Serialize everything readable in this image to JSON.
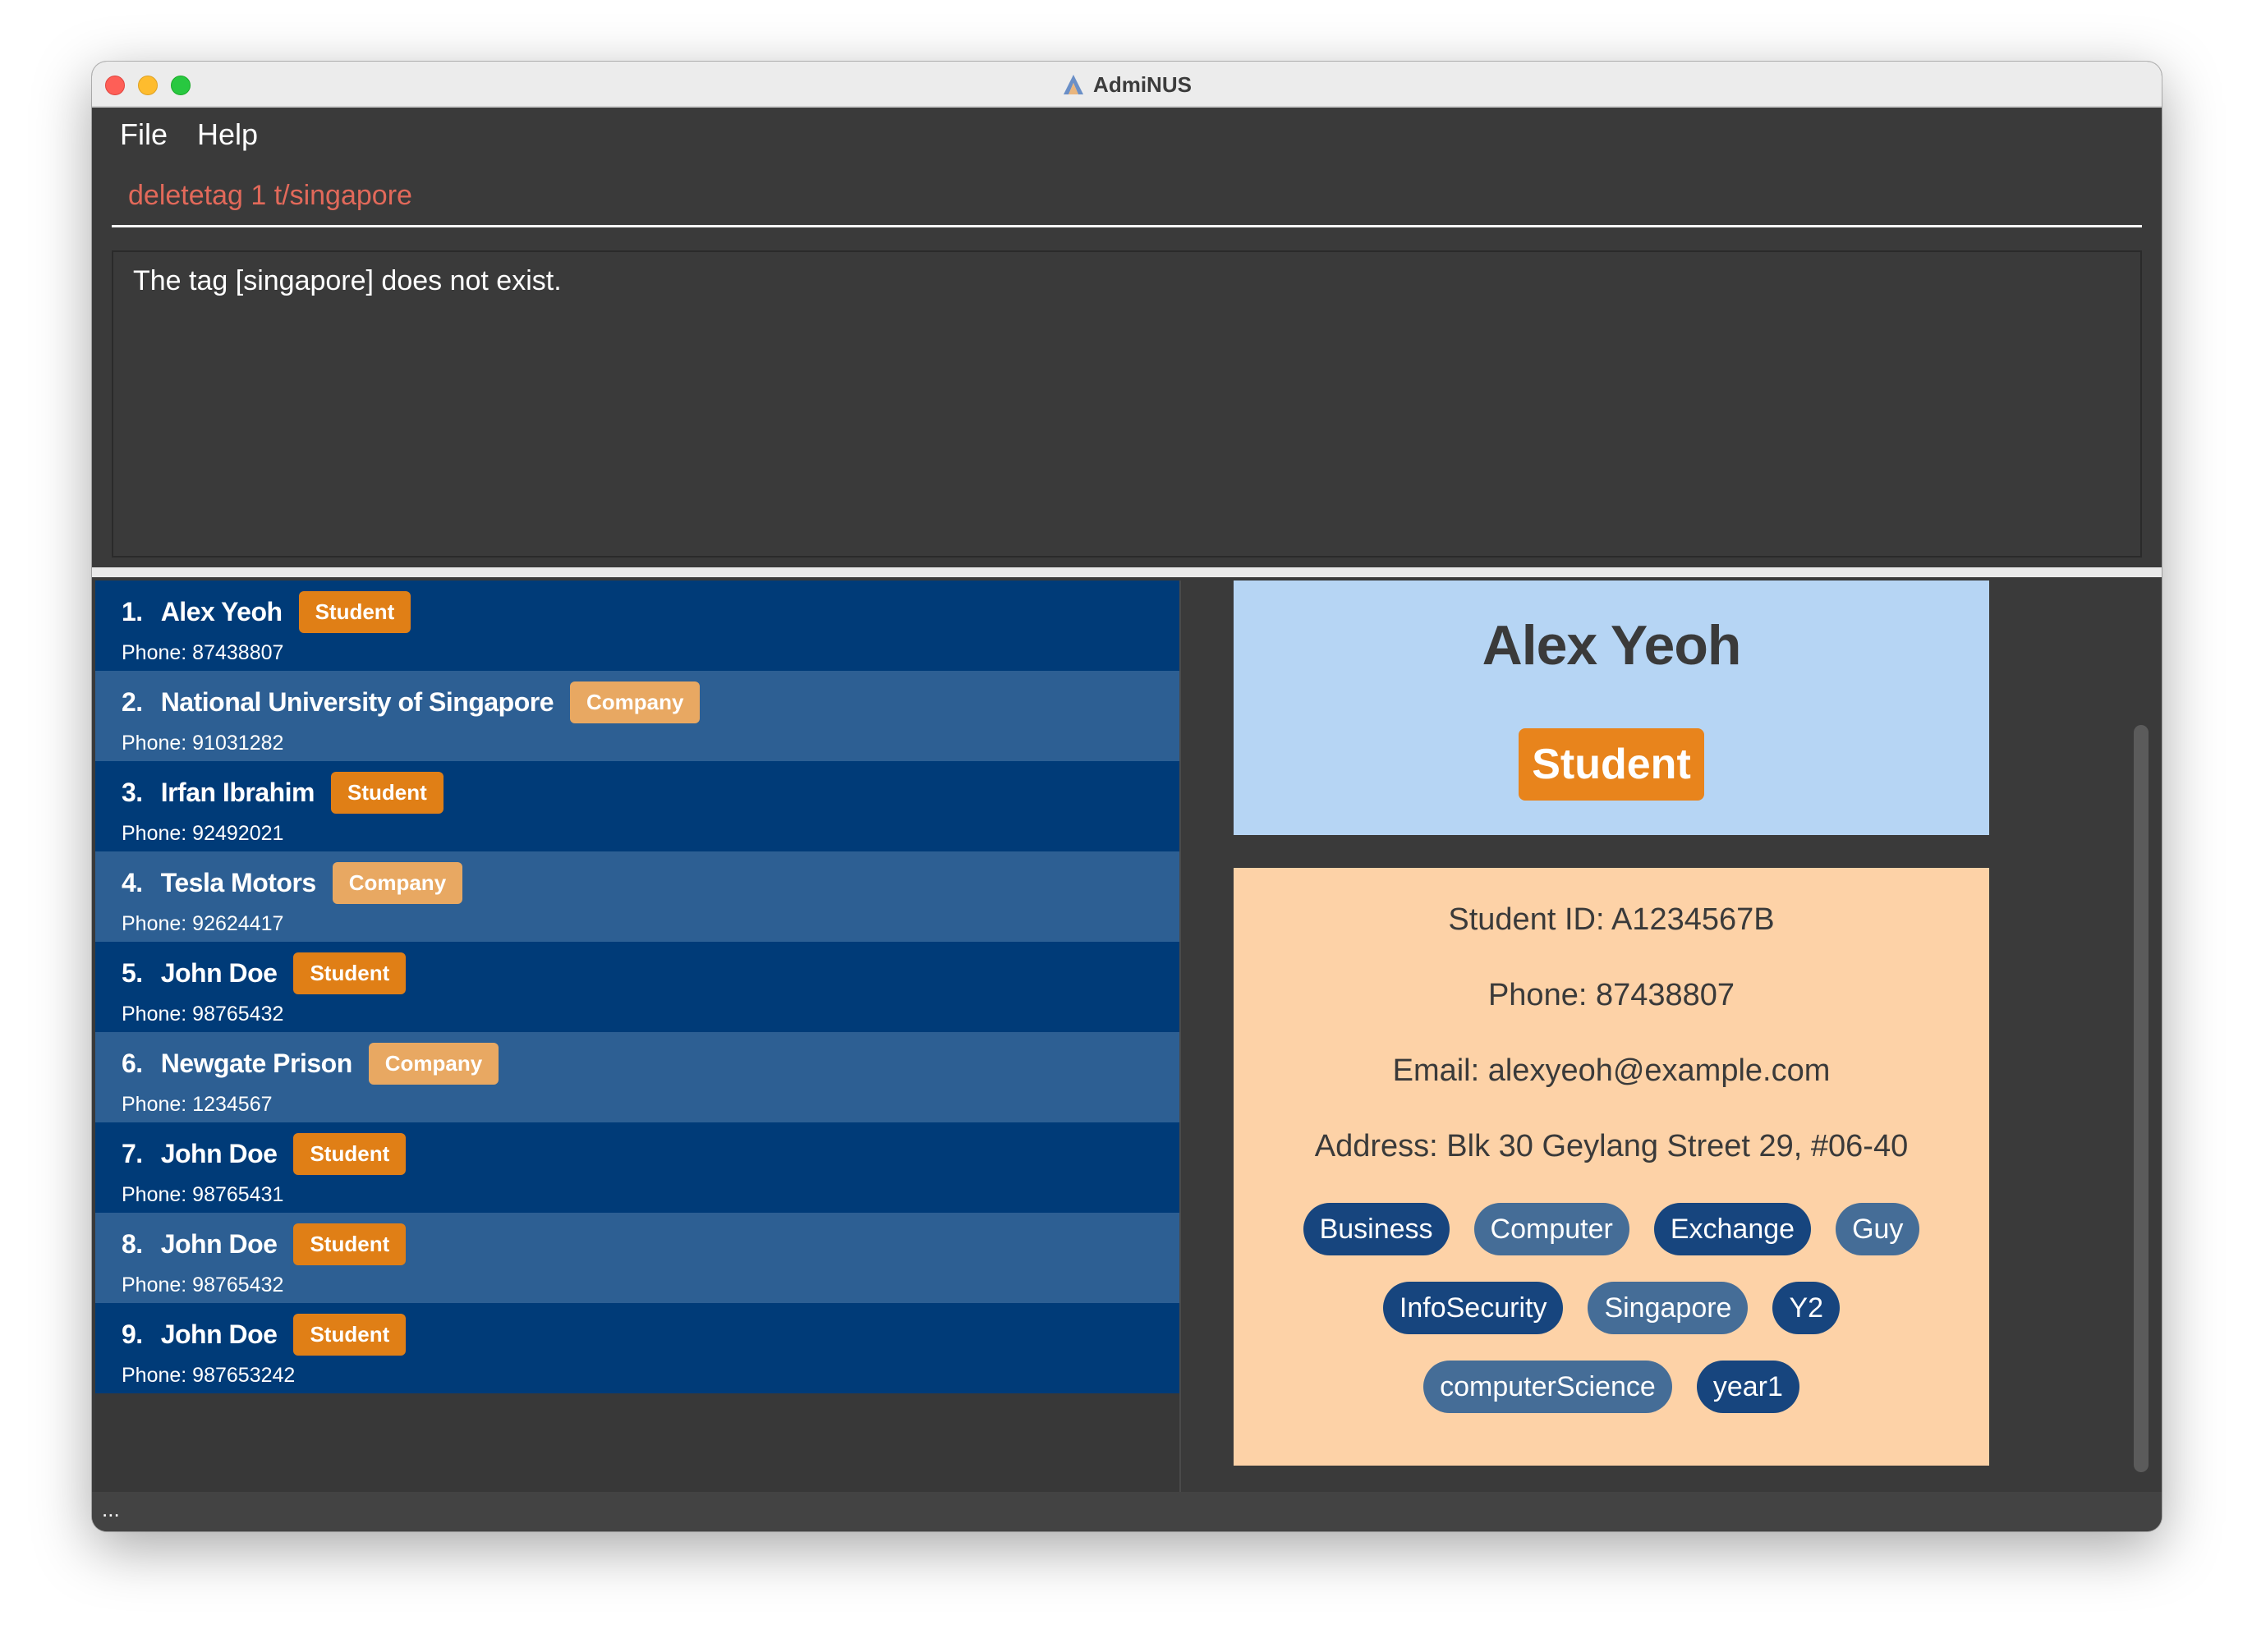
{
  "window": {
    "title": "AdmiNUS",
    "status": "..."
  },
  "menu": {
    "file": "File",
    "help": "Help"
  },
  "command": {
    "value": "deletetag 1 t/singapore",
    "placeholder": "",
    "color": "#e2695a"
  },
  "result": {
    "text": "The tag [singapore] does not exist."
  },
  "persons": [
    {
      "index": "1.",
      "name": "Alex Yeoh",
      "badge": "Student",
      "type": "student",
      "phone": "Phone: 87438807"
    },
    {
      "index": "2.",
      "name": "National University of Singapore",
      "badge": "Company",
      "type": "company",
      "phone": "Phone: 91031282"
    },
    {
      "index": "3.",
      "name": "Irfan Ibrahim",
      "badge": "Student",
      "type": "student",
      "phone": "Phone: 92492021"
    },
    {
      "index": "4.",
      "name": "Tesla Motors",
      "badge": "Company",
      "type": "company",
      "phone": "Phone: 92624417"
    },
    {
      "index": "5.",
      "name": "John Doe",
      "badge": "Student",
      "type": "student",
      "phone": "Phone: 98765432"
    },
    {
      "index": "6.",
      "name": "Newgate Prison",
      "badge": "Company",
      "type": "company",
      "phone": "Phone: 1234567"
    },
    {
      "index": "7.",
      "name": "John Doe",
      "badge": "Student",
      "type": "student",
      "phone": "Phone: 98765431"
    },
    {
      "index": "8.",
      "name": "John Doe",
      "badge": "Student",
      "type": "student",
      "phone": "Phone: 98765432"
    },
    {
      "index": "9.",
      "name": "John Doe",
      "badge": "Student",
      "type": "student",
      "phone": "Phone: 987653242"
    }
  ],
  "detail": {
    "name": "Alex Yeoh",
    "role": "Student",
    "student_id": "Student ID: A1234567B",
    "phone": "Phone: 87438807",
    "email": "Email: alexyeoh@example.com",
    "address": "Address: Blk 30 Geylang Street 29, #06-40",
    "tags": [
      [
        "Business",
        "Computer",
        "Exchange",
        "Guy"
      ],
      [
        "InfoSecurity",
        "Singapore",
        "Y2"
      ],
      [
        "computerScience",
        "year1"
      ]
    ]
  },
  "colors": {
    "student_badge": "#e07f16",
    "company_badge": "#e8a862",
    "row_dark": "#003b78",
    "row_light": "#2d5f93",
    "detail_header_bg": "#b6d5f4",
    "detail_body_bg": "#fdd2a7"
  }
}
